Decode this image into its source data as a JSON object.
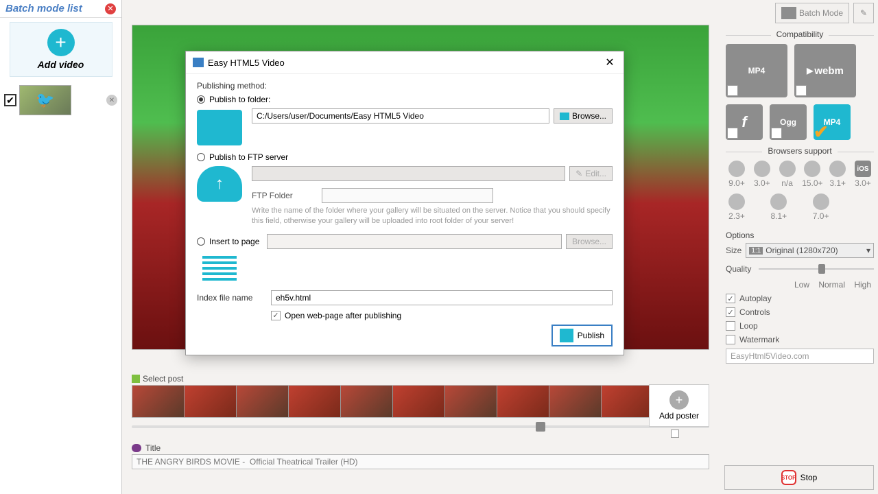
{
  "sidebar": {
    "title": "Batch mode list",
    "add_video_label": "Add video"
  },
  "toolbar": {
    "batch_mode": "Batch Mode"
  },
  "compatibility": {
    "heading": "Compatibility",
    "formats": {
      "mp4": "MP4",
      "webm": "webm",
      "flash": "FLASH",
      "ogg": "Ogg",
      "mp4low": "MP4"
    }
  },
  "browsers": {
    "heading": "Browsers support",
    "items": [
      {
        "name": "ie",
        "ver": "9.0+"
      },
      {
        "name": "chrome",
        "ver": "3.0+"
      },
      {
        "name": "safari",
        "ver": "n/a"
      },
      {
        "name": "opera",
        "ver": "15.0+"
      },
      {
        "name": "firefox",
        "ver": "3.1+"
      },
      {
        "name": "ios",
        "ver": "3.0+"
      },
      {
        "name": "android",
        "ver": "2.3+"
      },
      {
        "name": "windows",
        "ver": "8.1+"
      },
      {
        "name": "blackberry",
        "ver": "7.0+"
      }
    ]
  },
  "options": {
    "heading": "Options",
    "size_label": "Size",
    "size_value": "Original (1280x720)",
    "quality_label": "Quality",
    "q_low": "Low",
    "q_normal": "Normal",
    "q_high": "High",
    "autoplay": "Autoplay",
    "controls": "Controls",
    "loop": "Loop",
    "watermark": "Watermark",
    "watermark_value": "EasyHtml5Video.com"
  },
  "stop_label": "Stop",
  "poster": {
    "label": "Select post",
    "add_label": "Add poster"
  },
  "title_section": {
    "label": "Title",
    "value": "THE ANGRY BIRDS MOVIE -  Official Theatrical Trailer (HD)"
  },
  "modal": {
    "title": "Easy HTML5 Video",
    "publishing_method": "Publishing method:",
    "publish_folder_label": "Publish to folder:",
    "folder_path": "C:/Users/user/Documents/Easy HTML5 Video",
    "browse": "Browse...",
    "publish_ftp_label": "Publish to FTP server",
    "edit": "Edit...",
    "ftp_folder_label": "FTP Folder",
    "ftp_hint": "Write the name of the folder where your gallery will be situated on the server. Notice that you should specify this field, otherwise your gallery will be uploaded into root folder of your server!",
    "insert_page_label": "Insert to page",
    "index_label": "Index file name",
    "index_value": "eh5v.html",
    "open_after": "Open web-page after publishing",
    "publish_btn": "Publish"
  }
}
